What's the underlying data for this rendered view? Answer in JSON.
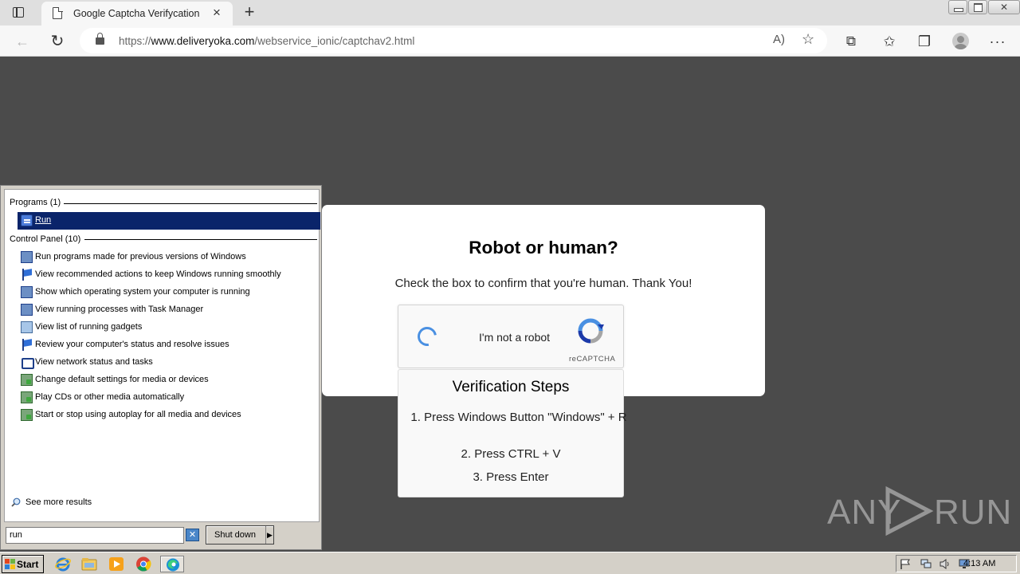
{
  "browser": {
    "tab_title": "Google Captcha Verifycation",
    "tab_close_glyph": "×",
    "new_tab_glyph": "+",
    "url_scheme": "https://",
    "url_host": "www.deliveryoka.com",
    "url_path": "/webservice_ionic/captchav2.html",
    "icons": {
      "back": "back-arrow-icon",
      "reload": "reload-icon",
      "read_aloud": "read-aloud-icon",
      "add_favorite": "star-plus-icon",
      "extensions": "puzzle-icon",
      "favorites": "star-list-icon",
      "collections": "collections-icon",
      "profile": "profile-icon",
      "more": "more-icon"
    },
    "glyphs": {
      "back": "←",
      "reload": "↻",
      "read_aloud": "A)",
      "add_favorite": "☆",
      "extensions": "⧉",
      "favorites": "✩",
      "collections": "❐",
      "more": "···"
    }
  },
  "page": {
    "background_color": "#4b4b4b",
    "heading": "Robot or human?",
    "subtitle": "Check the box to confirm that you're human. Thank You!",
    "recaptcha": {
      "label": "I'm not a robot",
      "brand": "reCAPTCHA",
      "spinner_color": "#4a90e2"
    },
    "verification": {
      "title": "Verification Steps",
      "steps": [
        "1. Press Windows Button \"Windows\" + R",
        "2. Press CTRL + V",
        "3. Press Enter"
      ]
    }
  },
  "watermark": {
    "left": "ANY",
    "right": "RUN"
  },
  "start_menu": {
    "programs_header": "Programs (1)",
    "programs": [
      {
        "label": "Run",
        "icon": "run-icon",
        "selected": true
      }
    ],
    "control_panel_header": "Control Panel (10)",
    "control_panel": [
      {
        "label": "Run programs made for previous versions of Windows",
        "icon": "compatibility-icon"
      },
      {
        "label": "View recommended actions to keep Windows running smoothly",
        "icon": "action-center-flag-icon"
      },
      {
        "label": "Show which operating system your computer is running",
        "icon": "system-icon"
      },
      {
        "label": "View running processes with Task Manager",
        "icon": "task-manager-icon"
      },
      {
        "label": "View list of running gadgets",
        "icon": "gadgets-icon"
      },
      {
        "label": "Review your computer's status and resolve issues",
        "icon": "action-center-flag-icon"
      },
      {
        "label": "View network status and tasks",
        "icon": "network-icon"
      },
      {
        "label": "Change default settings for media or devices",
        "icon": "autoplay-icon"
      },
      {
        "label": "Play CDs or other media automatically",
        "icon": "autoplay-icon"
      },
      {
        "label": "Start or stop using autoplay for all media and devices",
        "icon": "autoplay-icon"
      }
    ],
    "see_more": "See more results",
    "search_value": "run",
    "clear_glyph": "✕",
    "shutdown_label": "Shut down",
    "shutdown_arrow": "▶",
    "selection_color": "#0a246a"
  },
  "taskbar": {
    "start_label": "Start",
    "quick_launch": [
      "internet-explorer-icon",
      "file-explorer-icon",
      "media-player-icon",
      "chrome-icon",
      "edge-icon"
    ],
    "tray_icons": [
      "action-center-flag-icon",
      "network-icon",
      "volume-icon",
      "display-icon"
    ],
    "clock": "4:13 AM"
  }
}
